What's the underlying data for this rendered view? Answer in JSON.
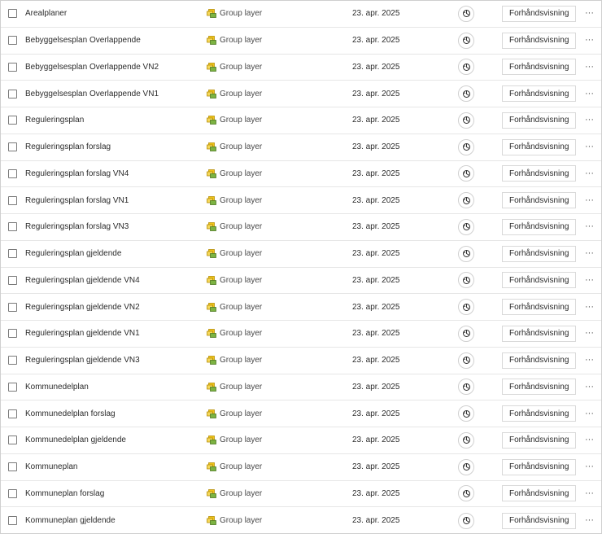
{
  "rows": [
    {
      "title": "Arealplaner",
      "type": "Group layer",
      "date": "23. apr. 2025",
      "preview": "Forhåndsvisning",
      "more": "···"
    },
    {
      "title": "Bebyggelsesplan Overlappende",
      "type": "Group layer",
      "date": "23. apr. 2025",
      "preview": "Forhåndsvisning",
      "more": "···"
    },
    {
      "title": "Bebyggelsesplan Overlappende VN2",
      "type": "Group layer",
      "date": "23. apr. 2025",
      "preview": "Forhåndsvisning",
      "more": "···"
    },
    {
      "title": "Bebyggelsesplan Overlappende VN1",
      "type": "Group layer",
      "date": "23. apr. 2025",
      "preview": "Forhåndsvisning",
      "more": "···"
    },
    {
      "title": "Reguleringsplan",
      "type": "Group layer",
      "date": "23. apr. 2025",
      "preview": "Forhåndsvisning",
      "more": "···"
    },
    {
      "title": "Reguleringsplan forslag",
      "type": "Group layer",
      "date": "23. apr. 2025",
      "preview": "Forhåndsvisning",
      "more": "···"
    },
    {
      "title": "Reguleringsplan forslag VN4",
      "type": "Group layer",
      "date": "23. apr. 2025",
      "preview": "Forhåndsvisning",
      "more": "···"
    },
    {
      "title": "Reguleringsplan forslag VN1",
      "type": "Group layer",
      "date": "23. apr. 2025",
      "preview": "Forhåndsvisning",
      "more": "···"
    },
    {
      "title": "Reguleringsplan forslag VN3",
      "type": "Group layer",
      "date": "23. apr. 2025",
      "preview": "Forhåndsvisning",
      "more": "···"
    },
    {
      "title": "Reguleringsplan gjeldende",
      "type": "Group layer",
      "date": "23. apr. 2025",
      "preview": "Forhåndsvisning",
      "more": "···"
    },
    {
      "title": "Reguleringsplan gjeldende VN4",
      "type": "Group layer",
      "date": "23. apr. 2025",
      "preview": "Forhåndsvisning",
      "more": "···"
    },
    {
      "title": "Reguleringsplan gjeldende VN2",
      "type": "Group layer",
      "date": "23. apr. 2025",
      "preview": "Forhåndsvisning",
      "more": "···"
    },
    {
      "title": "Reguleringsplan gjeldende VN1",
      "type": "Group layer",
      "date": "23. apr. 2025",
      "preview": "Forhåndsvisning",
      "more": "···"
    },
    {
      "title": "Reguleringsplan gjeldende VN3",
      "type": "Group layer",
      "date": "23. apr. 2025",
      "preview": "Forhåndsvisning",
      "more": "···"
    },
    {
      "title": "Kommunedelplan",
      "type": "Group layer",
      "date": "23. apr. 2025",
      "preview": "Forhåndsvisning",
      "more": "···"
    },
    {
      "title": "Kommunedelplan forslag",
      "type": "Group layer",
      "date": "23. apr. 2025",
      "preview": "Forhåndsvisning",
      "more": "···"
    },
    {
      "title": "Kommunedelplan gjeldende",
      "type": "Group layer",
      "date": "23. apr. 2025",
      "preview": "Forhåndsvisning",
      "more": "···"
    },
    {
      "title": "Kommuneplan",
      "type": "Group layer",
      "date": "23. apr. 2025",
      "preview": "Forhåndsvisning",
      "more": "···"
    },
    {
      "title": "Kommuneplan forslag",
      "type": "Group layer",
      "date": "23. apr. 2025",
      "preview": "Forhåndsvisning",
      "more": "···"
    },
    {
      "title": "Kommuneplan gjeldende",
      "type": "Group layer",
      "date": "23. apr. 2025",
      "preview": "Forhåndsvisning",
      "more": "···"
    }
  ],
  "icons": {
    "checkbox": "checkbox-icon",
    "type": "group-layer-icon",
    "share": "sharing-status-icon",
    "more": "more-options-icon"
  },
  "colors": {
    "group_layer_yellow": "#f0c419",
    "group_layer_green": "#7cb342",
    "row_divider": "#e6e6e6"
  }
}
